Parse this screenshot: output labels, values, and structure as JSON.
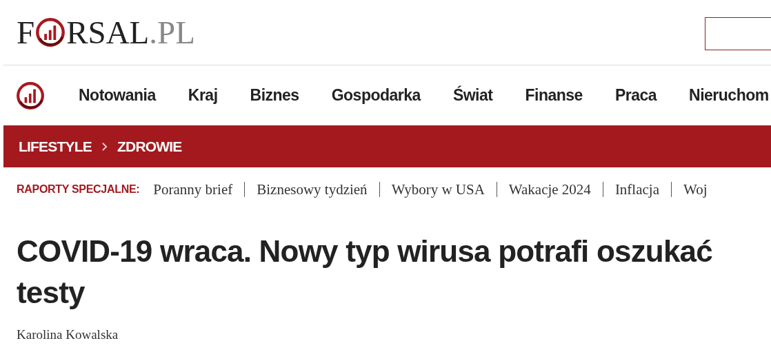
{
  "logo": {
    "first": "F",
    "rest": "RSAL",
    "suffix": ".PL"
  },
  "nav": [
    {
      "label": "Notowania"
    },
    {
      "label": "Kraj"
    },
    {
      "label": "Biznes"
    },
    {
      "label": "Gospodarka"
    },
    {
      "label": "Świat"
    },
    {
      "label": "Finanse"
    },
    {
      "label": "Praca"
    },
    {
      "label": "Nieruchom"
    }
  ],
  "breadcrumb": [
    "LIFESTYLE",
    "ZDROWIE"
  ],
  "reports": {
    "label": "RAPORTY SPECJALNE:",
    "items": [
      "Poranny brief",
      "Biznesowy tydzień",
      "Wybory w USA",
      "Wakacje 2024",
      "Inflacja",
      "Woj"
    ]
  },
  "article": {
    "title": "COVID-19 wraca. Nowy typ wirusa potrafi oszukać testy",
    "author": "Karolina Kowalska"
  }
}
